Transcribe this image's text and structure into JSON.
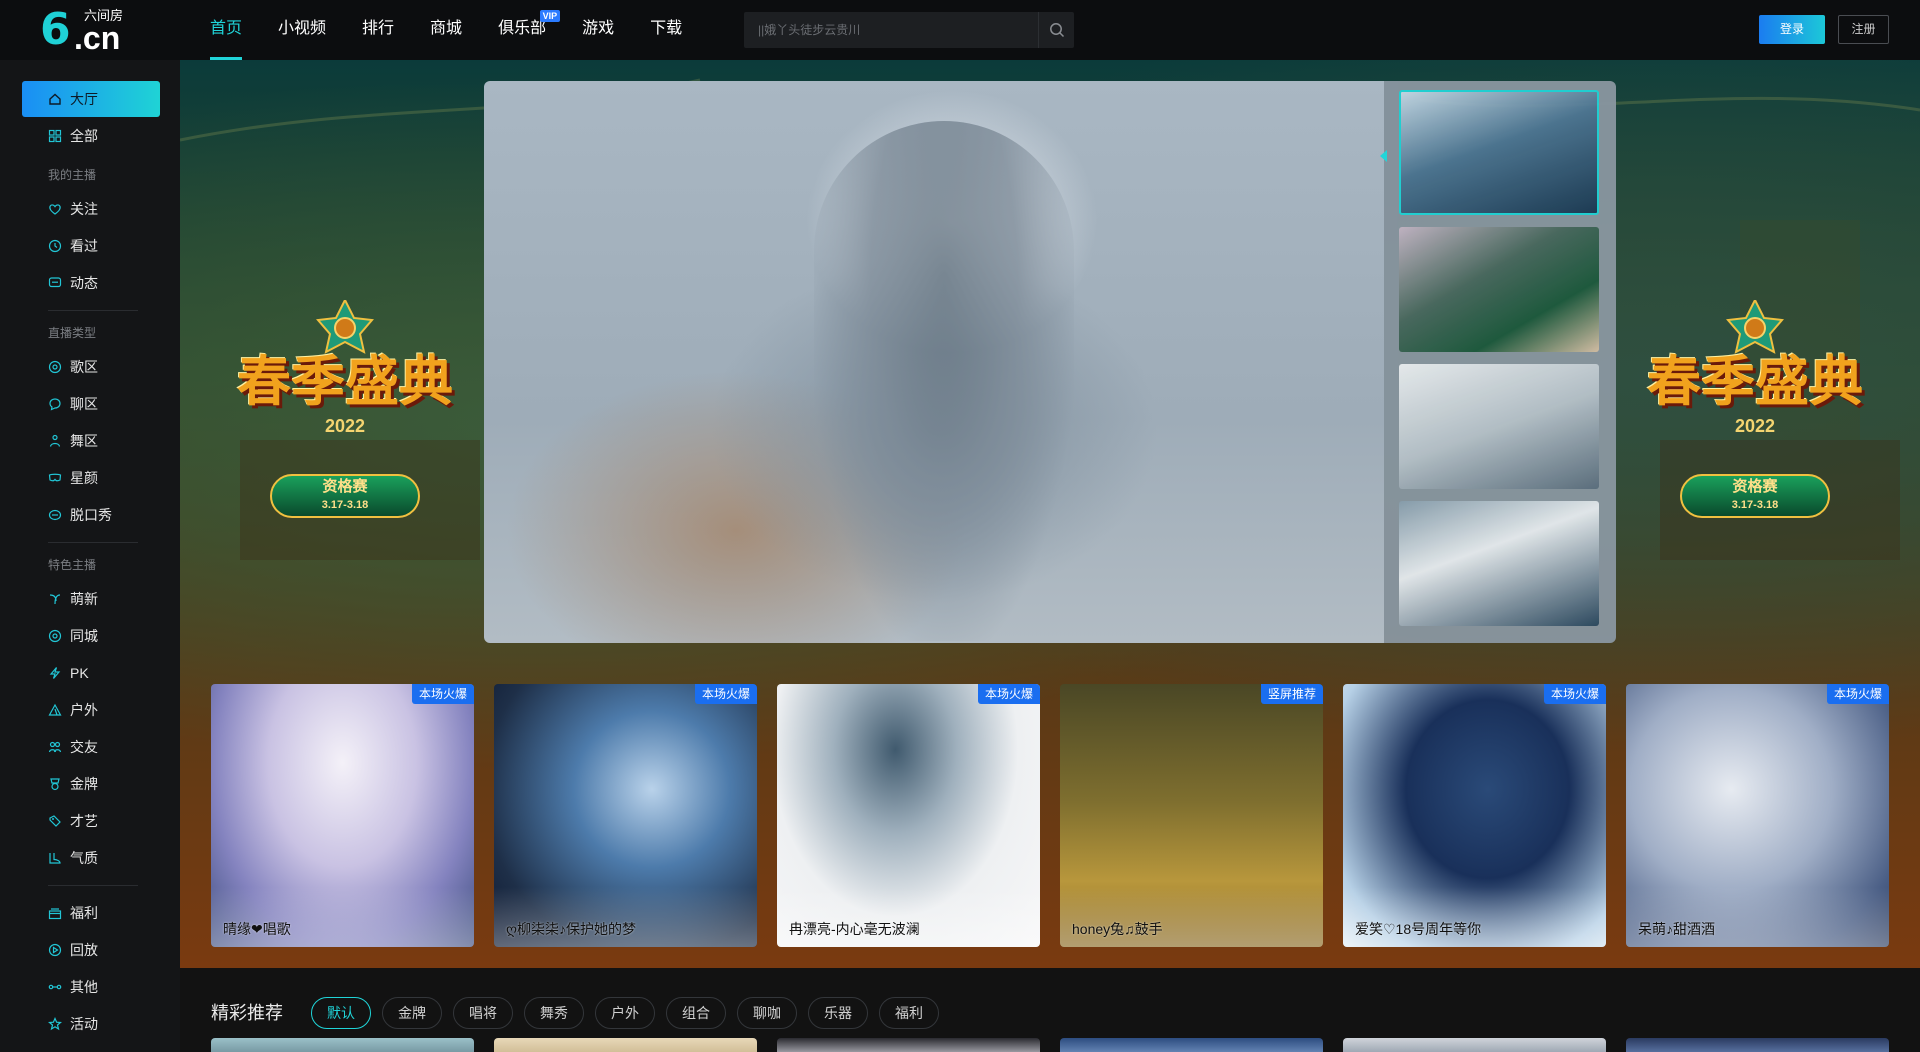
{
  "header": {
    "logo_sub": "六间房",
    "logo_six": "6",
    "logo_cn": ".cn",
    "nav": [
      {
        "label": "首页",
        "active": true
      },
      {
        "label": "小视频"
      },
      {
        "label": "排行"
      },
      {
        "label": "商城"
      },
      {
        "label": "俱乐部",
        "badge": "VIP"
      },
      {
        "label": "游戏"
      },
      {
        "label": "下载"
      }
    ],
    "search_placeholder": "||娥丫头徒步云贵川",
    "login_label": "登录",
    "register_label": "注册"
  },
  "sidebar": {
    "top": [
      {
        "label": "大厅",
        "icon": "home-icon",
        "active": true
      },
      {
        "label": "全部",
        "icon": "grid-icon"
      }
    ],
    "groups": [
      {
        "title": "我的主播",
        "items": [
          {
            "label": "关注",
            "icon": "heart-icon"
          },
          {
            "label": "看过",
            "icon": "clock-icon"
          },
          {
            "label": "动态",
            "icon": "message-icon"
          }
        ]
      },
      {
        "title": "直播类型",
        "items": [
          {
            "label": "歌区",
            "icon": "music-icon"
          },
          {
            "label": "聊区",
            "icon": "chat-icon"
          },
          {
            "label": "舞区",
            "icon": "dancer-icon"
          },
          {
            "label": "星颜",
            "icon": "mask-icon"
          },
          {
            "label": "脱口秀",
            "icon": "mic-icon"
          }
        ]
      },
      {
        "title": "特色主播",
        "items": [
          {
            "label": "萌新",
            "icon": "sprout-icon"
          },
          {
            "label": "同城",
            "icon": "location-icon"
          },
          {
            "label": "PK",
            "icon": "lightning-icon"
          },
          {
            "label": "户外",
            "icon": "tent-icon"
          },
          {
            "label": "交友",
            "icon": "people-icon"
          },
          {
            "label": "金牌",
            "icon": "medal-icon"
          },
          {
            "label": "才艺",
            "icon": "palette-icon"
          },
          {
            "label": "气质",
            "icon": "shoe-icon"
          }
        ]
      },
      {
        "title": "",
        "items": [
          {
            "label": "福利",
            "icon": "gift-icon"
          },
          {
            "label": "回放",
            "icon": "replay-icon"
          },
          {
            "label": "其他",
            "icon": "dots-icon"
          },
          {
            "label": "活动",
            "icon": "star-icon"
          }
        ]
      }
    ]
  },
  "banner": {
    "title": "春季盛典",
    "year": "2022",
    "qual_title": "资格赛",
    "qual_date": "3.17-3.18"
  },
  "cards": [
    {
      "name": "晴缘❤唱歌",
      "tag": "本场火爆",
      "colors": [
        "#d9d2ea",
        "#8e8cc4",
        "#3f5f88"
      ]
    },
    {
      "name": "ღ柳柒柒♪保护她的梦",
      "tag": "本场火爆",
      "colors": [
        "#1f2f45",
        "#3e6ea0",
        "#8fb7d8"
      ]
    },
    {
      "name": "冉漂亮-内心毫无波澜",
      "tag": "本场火爆",
      "colors": [
        "#f1f2f4",
        "#b8c1c8",
        "#5a6f80"
      ]
    },
    {
      "name": "honey兔♫鼓手",
      "tag": "竖屏推荐",
      "colors": [
        "#4a4a25",
        "#8b7b30",
        "#c8a640"
      ]
    },
    {
      "name": "爱笑♡18号周年等你",
      "tag": "本场火爆",
      "colors": [
        "#12284a",
        "#2e5c94",
        "#b7d3e8"
      ]
    },
    {
      "name": "呆萌♪甜酒酒",
      "tag": "本场火爆",
      "colors": [
        "#dfe4ec",
        "#93a2be",
        "#3f557c"
      ]
    }
  ],
  "bottom": {
    "title": "精彩推荐",
    "filters": [
      {
        "label": "默认",
        "active": true
      },
      {
        "label": "金牌"
      },
      {
        "label": "唱将"
      },
      {
        "label": "舞秀"
      },
      {
        "label": "户外"
      },
      {
        "label": "组合"
      },
      {
        "label": "聊咖"
      },
      {
        "label": "乐器"
      },
      {
        "label": "福利"
      }
    ]
  },
  "colors": {
    "accent": "#20d4d8",
    "brand_blue": "#1a6ef0",
    "header_bg": "#0c0d0f",
    "sidebar_bg": "#141517"
  }
}
